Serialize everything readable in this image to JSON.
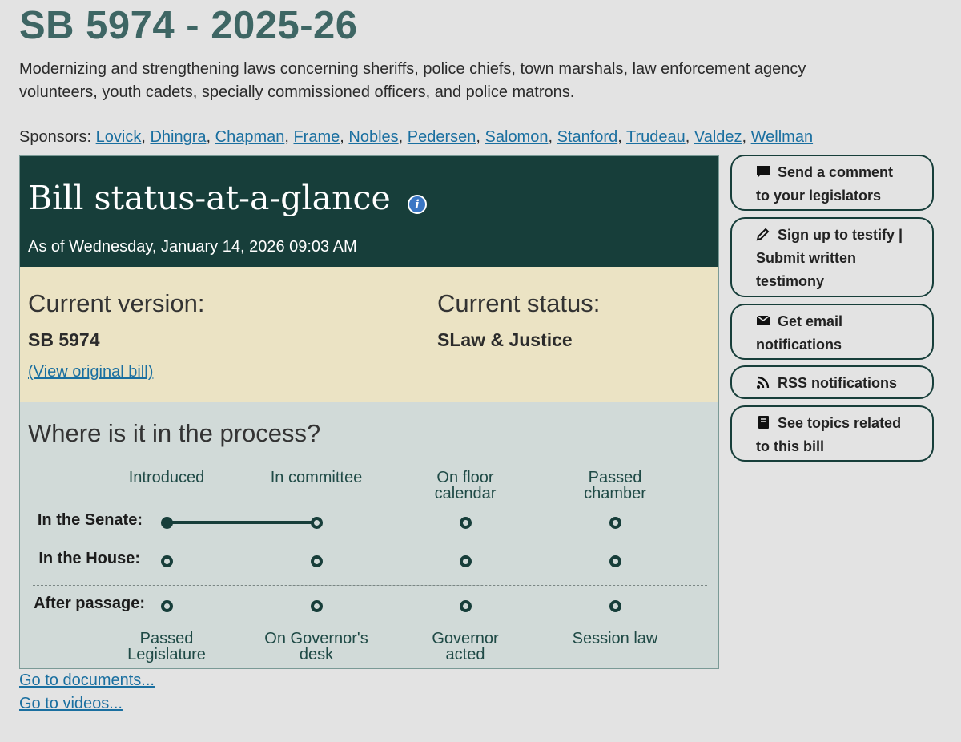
{
  "bill": {
    "title": "SB 5974 - 2025-26",
    "description": "Modernizing and strengthening laws concerning sheriffs, police chiefs, town marshals, law enforcement agency volunteers, youth cadets, specially commissioned officers, and police matrons."
  },
  "sponsors": {
    "label": "Sponsors:",
    "names": [
      "Lovick",
      "Dhingra",
      "Chapman",
      "Frame",
      "Nobles",
      "Pedersen",
      "Salomon",
      "Stanford",
      "Trudeau",
      "Valdez",
      "Wellman"
    ]
  },
  "status_panel": {
    "heading": "Bill status-at-a-glance",
    "info_icon": "info-icon",
    "as_of": "As of Wednesday, January 14, 2026 09:03 AM",
    "current_version_label": "Current version:",
    "current_version": "SB 5974",
    "view_original_link": "(View original bill)",
    "current_status_label": "Current status:",
    "current_status": "SLaw & Justice",
    "process_heading": "Where is it in the process?",
    "top_columns": [
      {
        "line1": "Introduced",
        "line2": ""
      },
      {
        "line1": "In committee",
        "line2": ""
      },
      {
        "line1": "On floor",
        "line2": "calendar"
      },
      {
        "line1": "Passed",
        "line2": "chamber"
      }
    ],
    "rows": [
      {
        "label": "In the Senate:",
        "stages_reached": 2
      },
      {
        "label": "In the House:",
        "stages_reached": 0
      }
    ],
    "after_passage": {
      "label": "After passage:",
      "stages_reached": 0
    },
    "bottom_columns": [
      {
        "line1": "Passed",
        "line2": "Legislature"
      },
      {
        "line1": "On Governor's",
        "line2": "desk"
      },
      {
        "line1": "Governor",
        "line2": "acted"
      },
      {
        "line1": "Session law",
        "line2": ""
      }
    ]
  },
  "links": {
    "documents": "Go to documents...",
    "videos": "Go to videos..."
  },
  "actions": [
    {
      "icon": "comment-icon",
      "line1": "Send a comment",
      "line2": "to your legislators",
      "line3": ""
    },
    {
      "icon": "pencil-icon",
      "line1": "Sign up to testify |",
      "line2": "Submit written",
      "line3": "testimony"
    },
    {
      "icon": "envelope-icon",
      "line1": "Get email",
      "line2": "notifications",
      "line3": ""
    },
    {
      "icon": "rss-icon",
      "line1": "RSS notifications",
      "line2": "",
      "line3": ""
    },
    {
      "icon": "book-icon",
      "line1": "See topics related",
      "line2": "to this bill",
      "line3": ""
    }
  ],
  "colors": {
    "title": "#3e6664",
    "panel_header": "#173e3a",
    "version_bg": "#ebe3c4",
    "process_bg": "#d1dad8",
    "link": "#1a6fa0"
  }
}
